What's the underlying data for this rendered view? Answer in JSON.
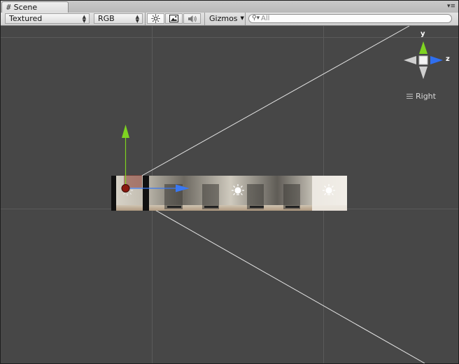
{
  "window": {
    "tab_title": "Scene",
    "tab_icon": "hash-grid-icon",
    "tab_menu_icon": "panel-menu-icon"
  },
  "toolbar": {
    "render_mode": "Textured",
    "color_mode": "RGB",
    "lighting_toggle": {
      "icon": "sun-icon",
      "active": true
    },
    "image_toggle": {
      "icon": "image-icon",
      "active": false
    },
    "audio_toggle": {
      "icon": "speaker-icon",
      "active": false
    },
    "gizmos_label": "Gizmos",
    "search_placeholder": "All"
  },
  "scene_gizmo": {
    "y_label": "y",
    "z_label": "z",
    "view_label": "Right",
    "colors": {
      "y": "#7ed321",
      "z": "#2f6ff0",
      "neutral": "#c8c8c8"
    }
  },
  "viewport": {
    "background": "#474747",
    "move_handle_colors": {
      "y": "#7ed321",
      "z": "#3a78f2"
    },
    "selected_object_color": "#8b1a10"
  }
}
